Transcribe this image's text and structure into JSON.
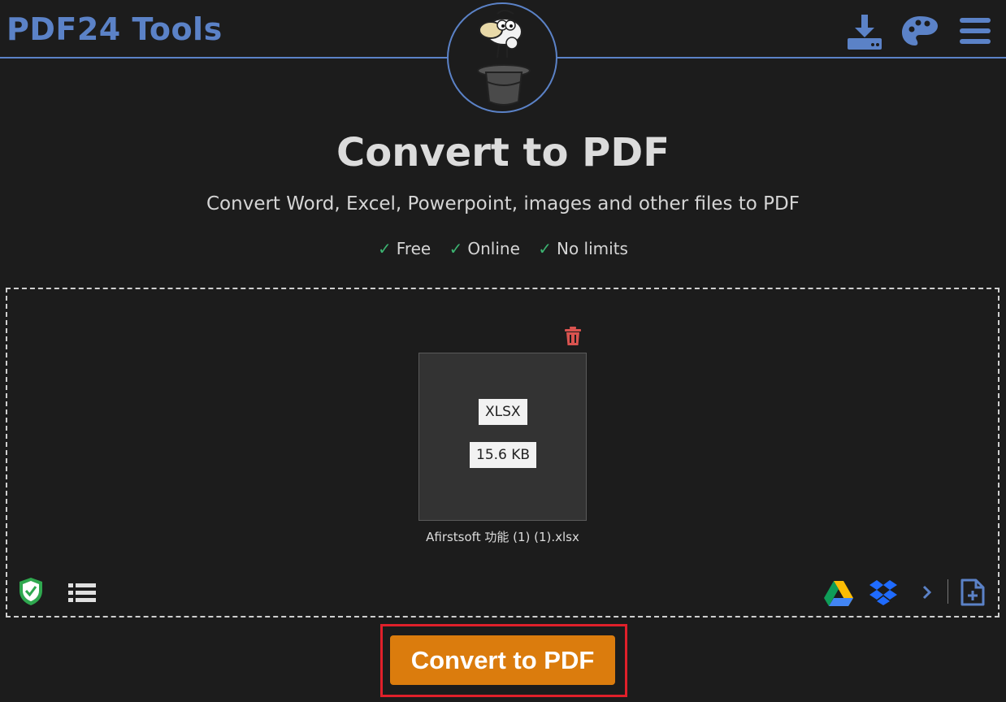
{
  "header": {
    "brand": "PDF24 Tools",
    "icons": [
      "download-icon",
      "palette-icon",
      "menu-icon"
    ],
    "accent": "#5b82c7"
  },
  "main": {
    "title": "Convert to PDF",
    "subtitle": "Convert Word, Excel, Powerpoint, images and other files to PDF",
    "features": [
      {
        "check": "✓",
        "label": "Free"
      },
      {
        "check": "✓",
        "label": "Online"
      },
      {
        "check": "✓",
        "label": "No limits"
      }
    ]
  },
  "file": {
    "type": "XLSX",
    "size": "15.6 KB",
    "name": "Afirstsoft 功能 (1) (1).xlsx"
  },
  "dropzone_icons": {
    "left": [
      "shield-icon",
      "list-icon"
    ],
    "right": [
      "google-drive-icon",
      "dropbox-icon",
      "chevron-right-icon",
      "add-file-icon"
    ]
  },
  "action": {
    "convert_label": "Convert to PDF",
    "button_color": "#db7c0d",
    "highlight_color": "#e0202a"
  }
}
